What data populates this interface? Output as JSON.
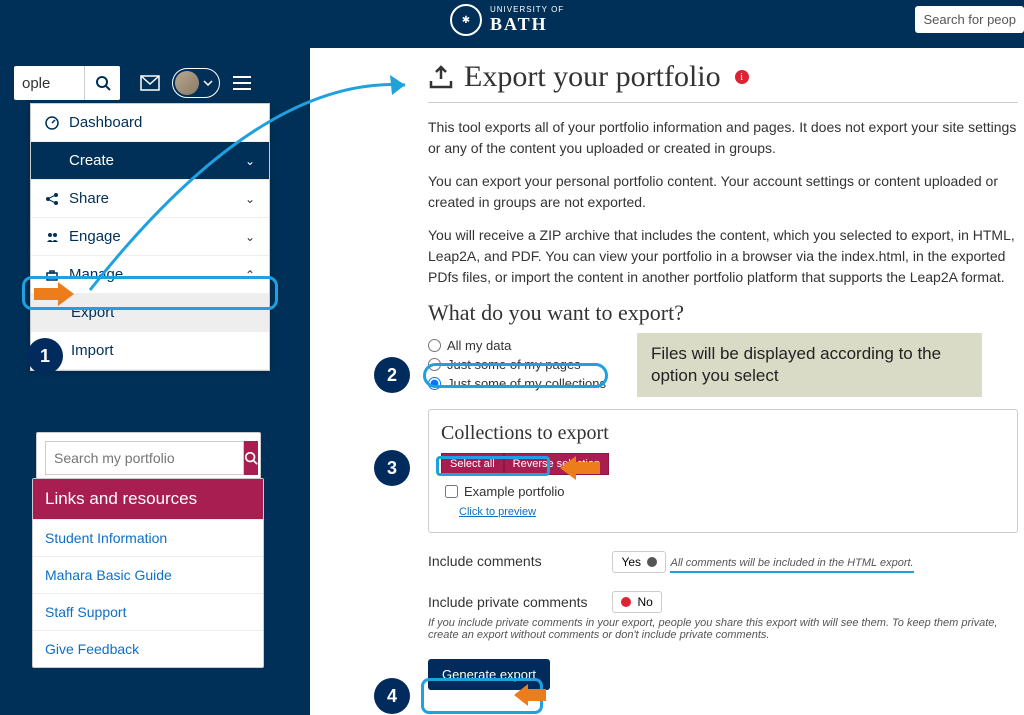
{
  "brand": {
    "univ": "UNIVERSITY OF",
    "name": "BATH"
  },
  "top_search_placeholder": "Search for peop",
  "left": {
    "search_value": "ople",
    "portfolio_search_placeholder": "Search my portfolio",
    "menu": {
      "dashboard": "Dashboard",
      "create": "Create",
      "share": "Share",
      "engage": "Engage",
      "manage": "Manage",
      "export": "Export",
      "import": "Import"
    },
    "links_heading": "Links and resources",
    "links": {
      "a": "Student Information",
      "b": "Mahara Basic Guide",
      "c": "Staff Support",
      "d": "Give Feedback"
    }
  },
  "main": {
    "title": "Export your portfolio",
    "p1": "This tool exports all of your portfolio information and pages. It does not export your site settings or any of the content you uploaded or created in groups.",
    "p2": "You can export your personal portfolio content. Your account settings or content uploaded or created in groups are not exported.",
    "p3": "You will receive a ZIP archive that includes the content, which you selected to export, in HTML, Leap2A, and PDF. You can view your portfolio in a browser via the index.html, in the exported PDfs files, or import the content in another portfolio platform that supports the Leap2A format.",
    "q_heading": "What do you want to export?",
    "opts": {
      "all": "All my data",
      "pages": "Just some of my pages",
      "coll": "Just some of my collections"
    },
    "callout": "Files will be displayed according to the option you select",
    "coll_heading": "Collections to export",
    "select_all": "Select all",
    "reverse": "Reverse selection",
    "example": "Example portfolio",
    "preview": "Click to preview",
    "inc_comments": "Include comments",
    "yes": "Yes",
    "comments_note": "All comments will be included in the HTML export.",
    "inc_private": "Include private comments",
    "no": "No",
    "private_note": "If you include private comments in your export, people you share this export with will see them. To keep them private, create an export without comments or don't include private comments.",
    "generate": "Generate export"
  },
  "steps": {
    "s1": "1",
    "s2": "2",
    "s3": "3",
    "s4": "4"
  }
}
